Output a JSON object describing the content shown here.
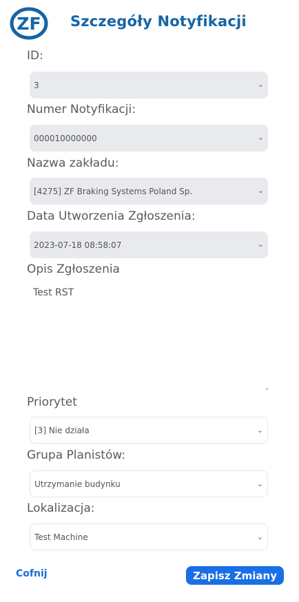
{
  "header": {
    "logo_text": "ZF",
    "title": "Szczegóły Notyfikacji"
  },
  "fields": {
    "id": {
      "label": "ID:",
      "value": "3"
    },
    "numer": {
      "label": "Numer Notyfikacji:",
      "value": "000010000000"
    },
    "zaklad": {
      "label": "Nazwa zakładu:",
      "value": "[4275] ZF Braking Systems Poland Sp."
    },
    "data": {
      "label": "Data Utworzenia Zgłoszenia:",
      "value": "2023-07-18 08:58:07"
    },
    "opis": {
      "label": "Opis Zgłoszenia",
      "value": "Test RST"
    },
    "priorytet": {
      "label": "Priorytet",
      "value": "[3] Nie działa"
    },
    "grupa": {
      "label": "Grupa Planistów:",
      "value": "Utrzymanie budynku"
    },
    "lokalizacja": {
      "label": "Lokalizacja:",
      "value": "Test Machine"
    }
  },
  "actions": {
    "back": "Cofnij",
    "save": "Zapisz Zmiany"
  },
  "colors": {
    "brand": "#1565a6",
    "button": "#1a6ee6",
    "disabled_bg": "#e8eaed"
  }
}
